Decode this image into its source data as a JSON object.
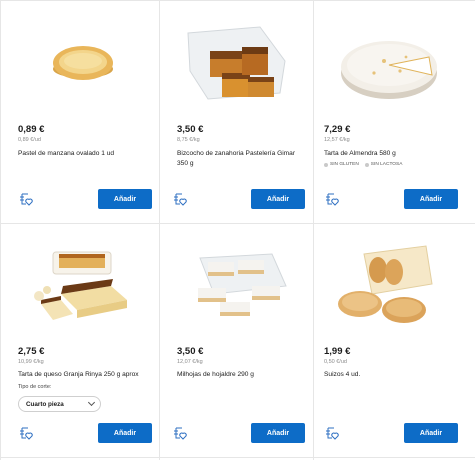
{
  "colors": {
    "accent": "#0d6cc7",
    "divider": "#e6e6e6"
  },
  "icons": {
    "favorite": "list-heart-icon",
    "dropdown": "chevron-down-icon"
  },
  "products": [
    {
      "price": "0,89 €",
      "unit_price": "0,89 €/ud",
      "name": "Pastel de manzana ovalado 1 ud",
      "add_label": "Añadir"
    },
    {
      "price": "3,50 €",
      "unit_price": "8,75 €/kg",
      "name": "Bizcocho de zanahoria Pastelería Gimar 350 g",
      "add_label": "Añadir"
    },
    {
      "price": "7,29 €",
      "unit_price": "12,57 €/kg",
      "name": "Tarta de Almendra 580 g",
      "tags": [
        "SIN GLUTEN",
        "SIN LACTOSA"
      ],
      "add_label": "Añadir"
    },
    {
      "price": "2,75 €",
      "unit_price": "10,99 €/kg",
      "name": "Tarta de queso Granja Rinya 250 g aprox",
      "cut_label": "Tipo de corte:",
      "cut_value": "Cuarto pieza",
      "add_label": "Añadir"
    },
    {
      "price": "3,50 €",
      "unit_price": "12,07 €/kg",
      "name": "Milhojas de hojaldre 290 g",
      "add_label": "Añadir"
    },
    {
      "price": "1,99 €",
      "unit_price": "0,50 €/ud",
      "name": "Suizos 4 ud.",
      "add_label": "Añadir"
    }
  ]
}
